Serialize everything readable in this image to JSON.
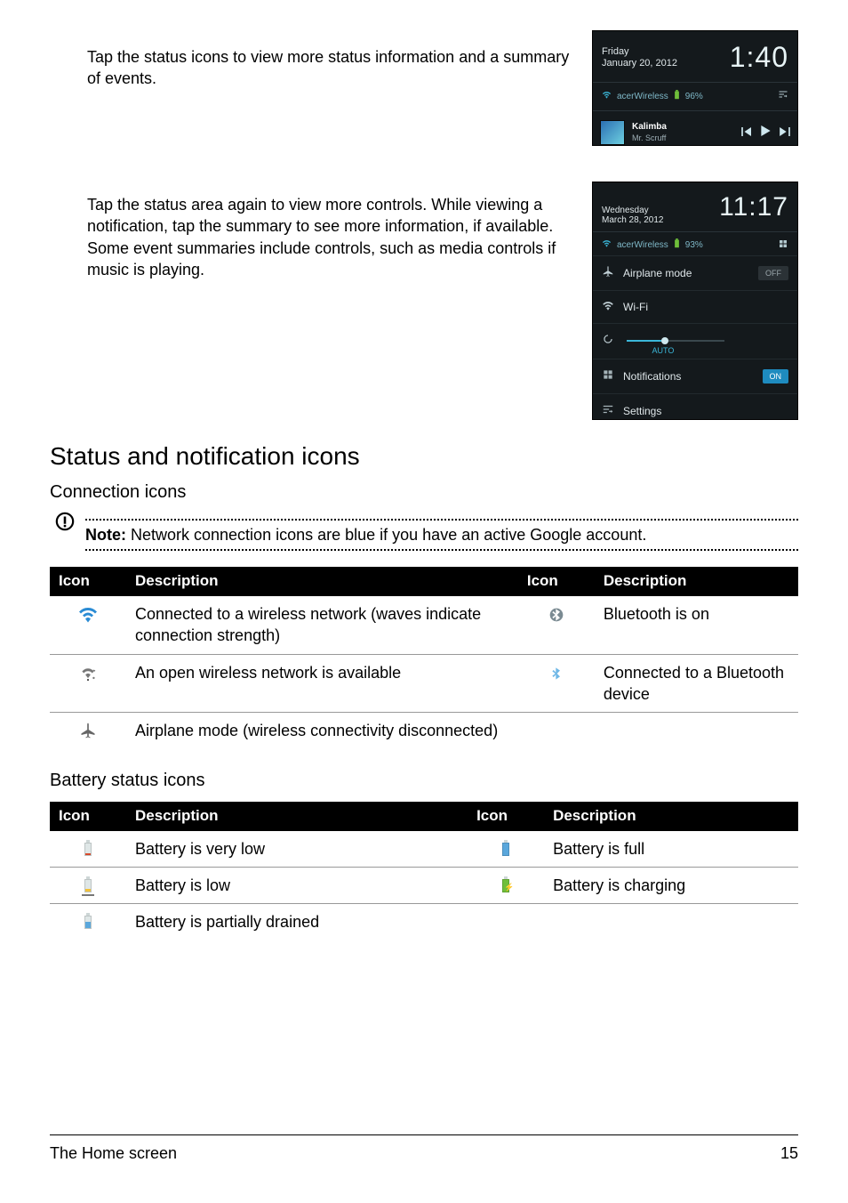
{
  "intro": {
    "para1": "Tap the status icons to view more status information and a summary of events.",
    "para2": "Tap the status area again to view more controls. While viewing a notification, tap the summary to see more information, if available. Some event summaries include controls, such as media controls if music is playing."
  },
  "shot1": {
    "day": "Friday",
    "date": "January 20, 2012",
    "time": "1:40",
    "wifi_name": "acerWireless",
    "battery_pct": "96%",
    "track_title": "Kalimba",
    "track_artist": "Mr. Scruff"
  },
  "shot2": {
    "day": "Wednesday",
    "date": "March 28, 2012",
    "time": "11:17",
    "wifi_name": "acerWireless",
    "battery_pct": "93%",
    "items": {
      "airplane": "Airplane mode",
      "airplane_toggle": "OFF",
      "wifi": "Wi-Fi",
      "brightness_auto": "AUTO",
      "notifications": "Notifications",
      "notifications_toggle": "ON",
      "settings": "Settings"
    }
  },
  "section_heading": "Status and notification icons",
  "subhead_connection": "Connection icons",
  "note_label": "Note:",
  "note_text": " Network connection icons are blue if you have an active Google account.",
  "table_headers": {
    "icon": "Icon",
    "desc": "Description"
  },
  "connection_rows": [
    {
      "left": "Connected to a wireless network (waves indicate connection strength)",
      "right": "Bluetooth is on"
    },
    {
      "left": "An open wireless network is available",
      "right": "Connected to a Bluetooth device"
    },
    {
      "left": "Airplane mode (wireless connectivity disconnected)",
      "right": ""
    }
  ],
  "subhead_battery": "Battery status icons",
  "battery_rows": [
    {
      "left": "Battery is very low",
      "right": "Battery is full"
    },
    {
      "left": "Battery is low",
      "right": "Battery is charging"
    },
    {
      "left": "Battery is partially drained",
      "right": ""
    }
  ],
  "footer": {
    "section": "The Home screen",
    "page": "15"
  }
}
